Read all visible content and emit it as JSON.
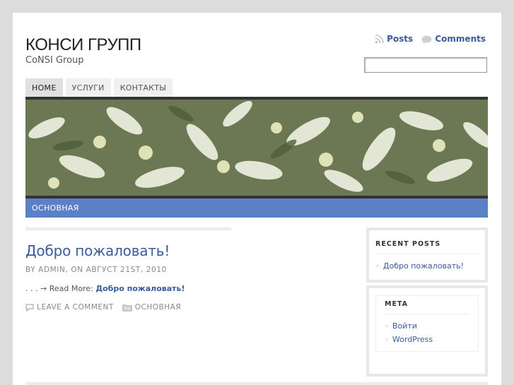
{
  "header": {
    "site_title": "КОНСИ ГРУПП",
    "site_description": "CoNSI Group",
    "feed_posts": "Posts",
    "feed_comments": "Comments",
    "search_value": ""
  },
  "nav": {
    "items": [
      "HOME",
      "УСЛУГИ",
      "КОНТАКТЫ"
    ],
    "active": "HOME"
  },
  "category_bar": "ОСНОВНАЯ",
  "post": {
    "title": "Добро пожаловать!",
    "meta": "BY ADMIN, ON АВГУСТ 21ST, 2010",
    "excerpt_prefix": ". . . → Read More:",
    "read_more_link": "Добро пожаловать!",
    "leave_comment": "LEAVE A COMMENT",
    "category": "ОСНОВНАЯ"
  },
  "sidebar": {
    "recent_posts": {
      "title": "RECENT POSTS",
      "items": [
        "Добро пожаловать!"
      ]
    },
    "meta": {
      "title": "META",
      "items": [
        "Войти",
        "WordPress"
      ]
    }
  },
  "colors": {
    "accent": "#5b80c6",
    "link": "#3a5b9b",
    "background": "#dcdcdc"
  },
  "icons": {
    "posts": "rss-icon",
    "comments": "speech-bubble-icon",
    "comment": "comment-icon",
    "category": "folder-icon"
  }
}
